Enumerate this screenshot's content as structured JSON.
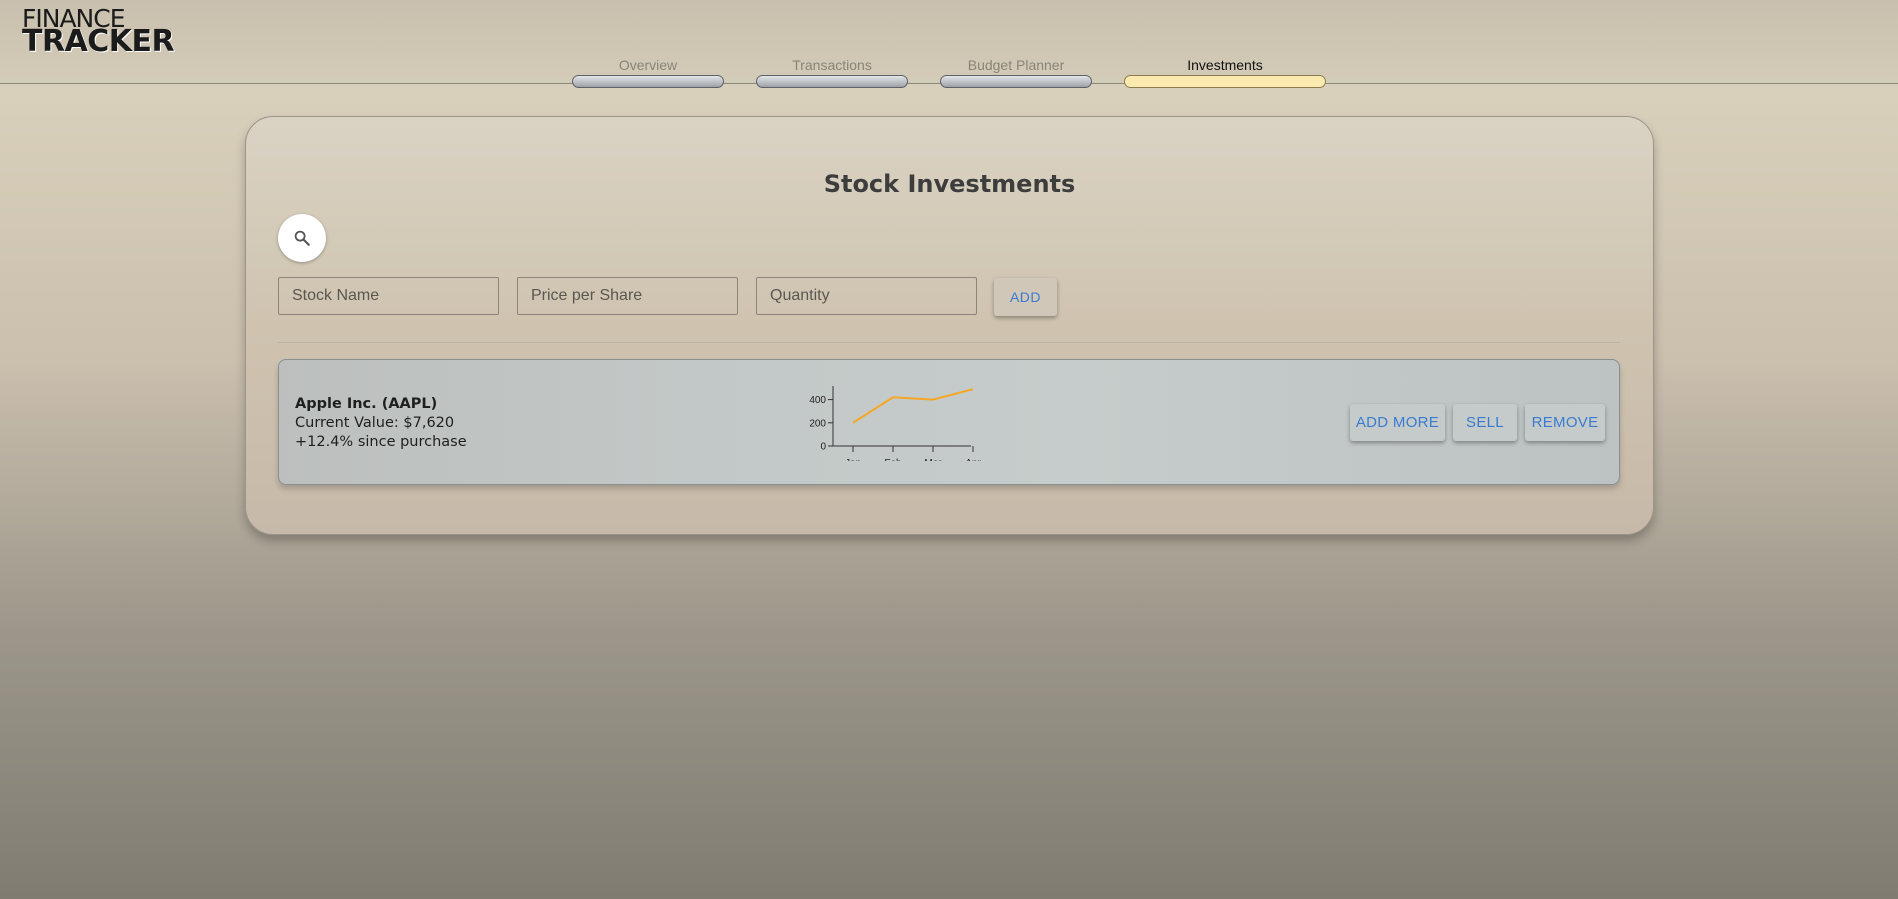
{
  "app": {
    "logo_top": "FINANCE",
    "logo_bottom": "TRACKER"
  },
  "nav": {
    "tabs": [
      {
        "label": "Overview",
        "active": false
      },
      {
        "label": "Transactions",
        "active": false
      },
      {
        "label": "Budget Planner",
        "active": false
      },
      {
        "label": "Investments",
        "active": true
      }
    ]
  },
  "panel": {
    "title": "Stock Investments",
    "search_icon": "search-icon",
    "form": {
      "stock_name_placeholder": "Stock Name",
      "stock_name_value": "",
      "price_placeholder": "Price per Share",
      "price_value": "",
      "quantity_placeholder": "Quantity",
      "quantity_value": "",
      "add_label": "ADD"
    }
  },
  "holdings": [
    {
      "name": "Apple Inc. (AAPL)",
      "current_value": "Current Value: $7,620",
      "change": "+12.4% since purchase",
      "buttons": {
        "add_more": "ADD MORE",
        "sell": "SELL",
        "remove": "REMOVE"
      }
    }
  ],
  "colors": {
    "accent": "#3a7bd0",
    "active_tab": "#fbeab0",
    "chart_line": "#f5a623"
  },
  "chart_data": {
    "type": "line",
    "categories": [
      "Jan",
      "Feb",
      "Mar",
      "Apr"
    ],
    "values": [
      200,
      420,
      400,
      490
    ],
    "y_ticks": [
      0,
      200,
      400
    ],
    "ylim": [
      0,
      500
    ],
    "title": "",
    "xlabel": "",
    "ylabel": "",
    "grid": false
  }
}
